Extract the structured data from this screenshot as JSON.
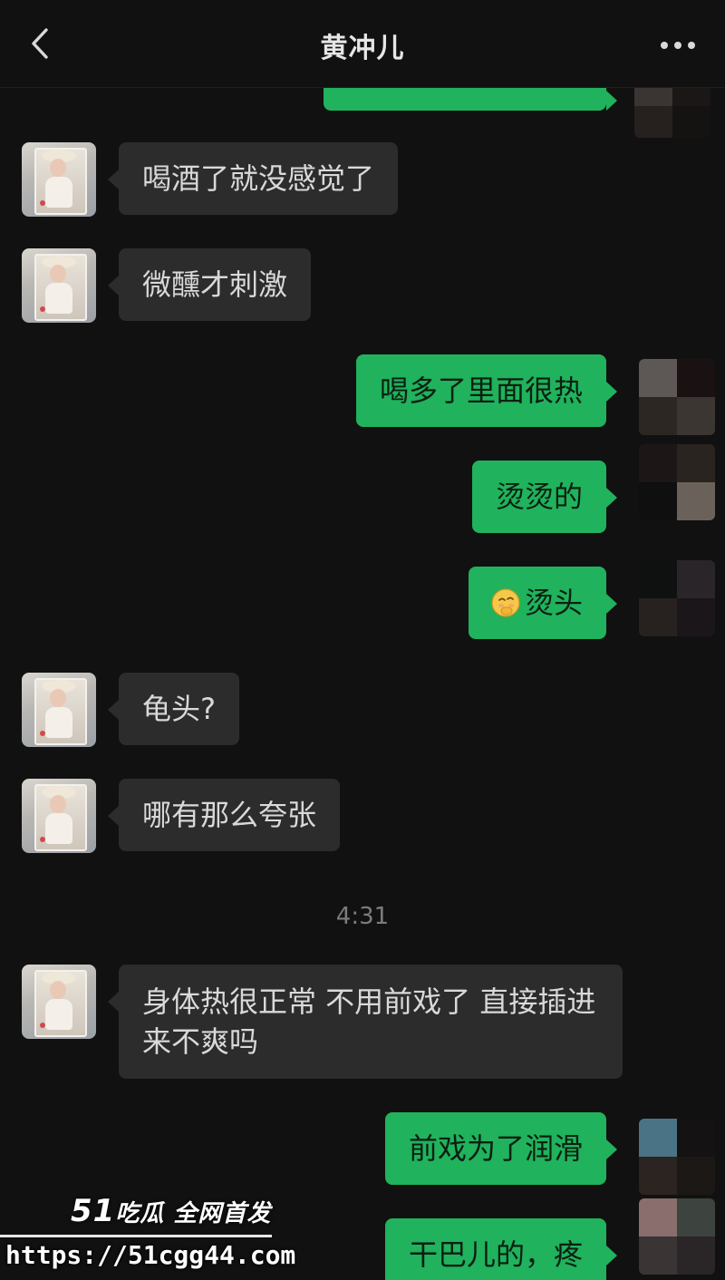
{
  "header": {
    "title": "黄冲儿",
    "back_icon": "chevron-left-icon",
    "more_icon": "more-dots-icon"
  },
  "colors": {
    "background": "#111111",
    "incoming_bubble": "#2c2c2c",
    "outgoing_bubble": "#20b25c"
  },
  "messages": [
    {
      "side": "out",
      "text": ""
    },
    {
      "side": "in",
      "text": "喝酒了就没感觉了"
    },
    {
      "side": "in",
      "text": "微醺才刺激"
    },
    {
      "side": "out",
      "text": "喝多了里面很热"
    },
    {
      "side": "out",
      "text": "烫烫的"
    },
    {
      "side": "out",
      "emoji": "shy-face-emoji",
      "text": "烫头"
    },
    {
      "side": "in",
      "text": "龟头?"
    },
    {
      "side": "in",
      "text": "哪有那么夸张"
    },
    {
      "side": "in",
      "text": "身体热很正常 不用前戏了 直接插进来不爽吗"
    },
    {
      "side": "out",
      "text": "前戏为了润滑"
    },
    {
      "side": "out",
      "text": "干巴儿的，疼"
    }
  ],
  "timestamp": "4:31",
  "watermark": {
    "brand_number": "51",
    "brand_text": "吃瓜 全网首发",
    "url": "https://51cgg44.com"
  }
}
